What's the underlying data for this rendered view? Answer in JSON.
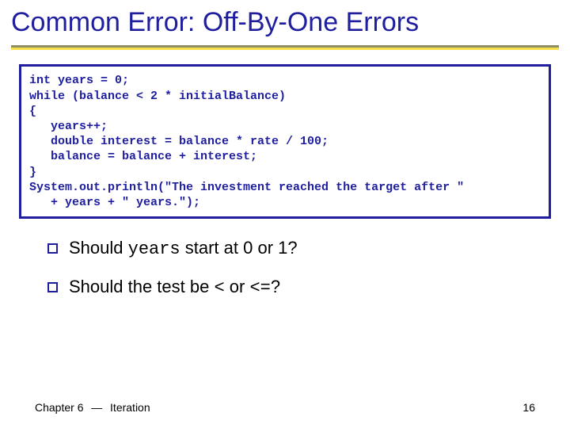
{
  "title": "Common Error: Off-By-One Errors",
  "code": "int years = 0;\nwhile (balance < 2 * initialBalance)\n{\n   years++;\n   double interest = balance * rate / 100;\n   balance = balance + interest;\n}\nSystem.out.println(\"The investment reached the target after \"\n   + years + \" years.\");",
  "bullets": {
    "b1_pre": "Should ",
    "b1_mono": "years",
    "b1_post": " start at 0 or 1?",
    "b2_pre": "Should the test be ",
    "b2_mono1": "<",
    "b2_mid": " or ",
    "b2_mono2": "<=",
    "b2_post": "?"
  },
  "footer": {
    "left_a": "Chapter 6",
    "left_b": "Iteration",
    "page": "16"
  }
}
